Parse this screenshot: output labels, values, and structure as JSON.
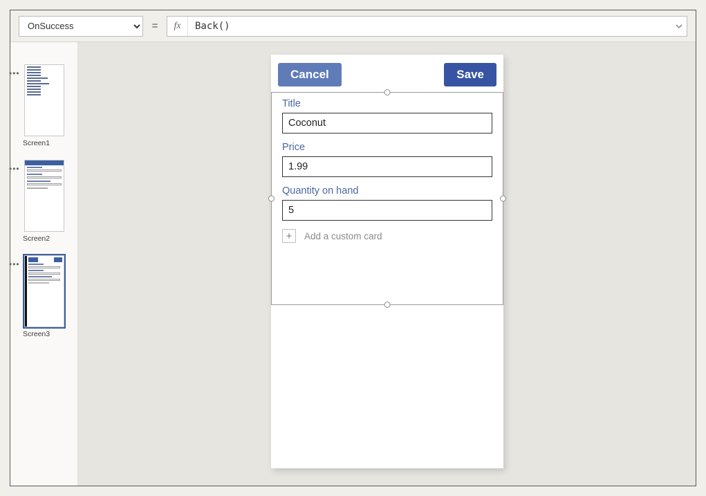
{
  "formula_bar": {
    "property": "OnSuccess",
    "equals": "=",
    "fx": "fx",
    "expression": "Back()"
  },
  "thumbnails": {
    "items": [
      {
        "label": "Screen1"
      },
      {
        "label": "Screen2"
      },
      {
        "label": "Screen3"
      }
    ]
  },
  "app": {
    "cancel_label": "Cancel",
    "save_label": "Save",
    "fields": {
      "title": {
        "label": "Title",
        "value": "Coconut"
      },
      "price": {
        "label": "Price",
        "value": "1.99"
      },
      "qty": {
        "label": "Quantity on hand",
        "value": "5"
      }
    },
    "add_card": {
      "plus": "+",
      "text": "Add a custom card"
    }
  }
}
